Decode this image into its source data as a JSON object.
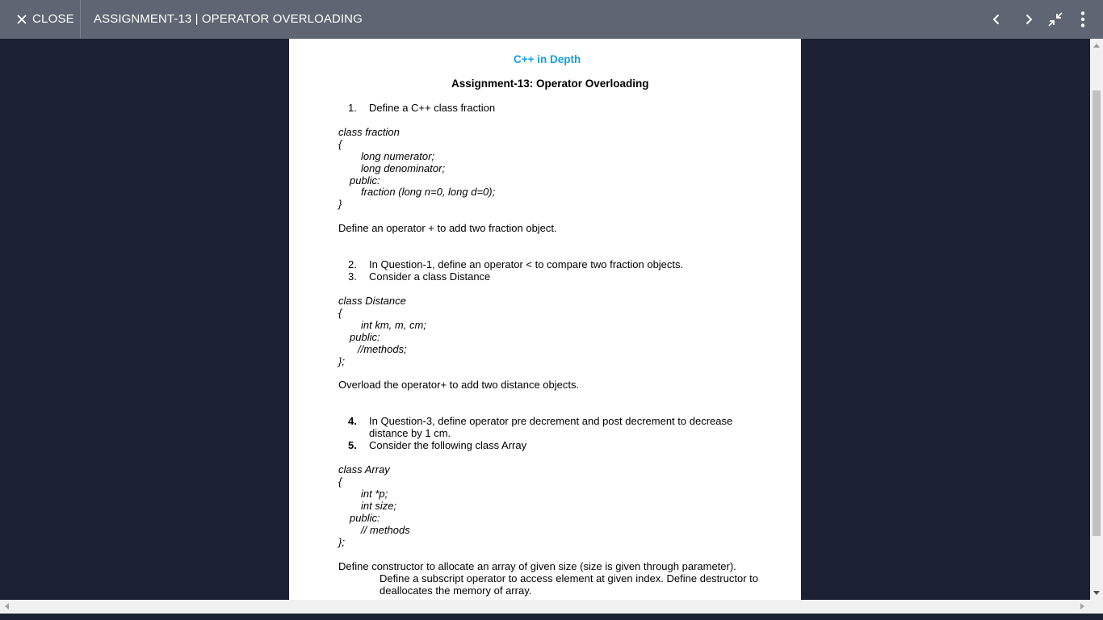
{
  "toolbar": {
    "close_label": "CLOSE",
    "title": "ASSIGNMENT-13 | OPERATOR OVERLOADING",
    "icons": [
      "close-icon",
      "chevron-left-icon",
      "chevron-right-icon",
      "exit-fullscreen-icon",
      "more-vert-icon"
    ]
  },
  "document": {
    "course": "C++ in Depth",
    "assignment": "Assignment-13: Operator Overloading",
    "q1": {
      "num": "1.",
      "text": "Define a C++ class fraction"
    },
    "code1": [
      "class fraction",
      "{",
      "long numerator;",
      "long denominator;",
      "public:",
      "fraction (long n=0, long d=0);",
      "}"
    ],
    "q1_task": "Define an operator + to add two fraction object.",
    "q2": {
      "num": "2.",
      "text": "In Question-1, define an operator < to compare two fraction objects."
    },
    "q3": {
      "num": "3.",
      "text": "Consider a class Distance"
    },
    "code2": [
      "class Distance",
      "{",
      "int km, m, cm;",
      "public:",
      "//methods;",
      "};"
    ],
    "q3_task": "Overload the operator+ to add two distance objects.",
    "q4": {
      "num": "4.",
      "text": "In Question-3, define operator pre decrement and post decrement to decrease",
      "text2": "distance by 1 cm."
    },
    "q5": {
      "num": "5.",
      "text": "Consider the following class Array"
    },
    "code3": [
      "class Array",
      "{",
      "int *p;",
      "int size;",
      "public:",
      "// methods",
      "};"
    ],
    "q5_task": [
      "Define constructor to allocate an array of given size (size is given through parameter).",
      "Define a subscript operator to access element at given index. Define destructor to",
      "deallocates the memory of array."
    ]
  },
  "colors": {
    "toolbar_bg": "#5f6572",
    "viewer_bg": "#1b2033",
    "heading_blue": "#13a0e6"
  }
}
